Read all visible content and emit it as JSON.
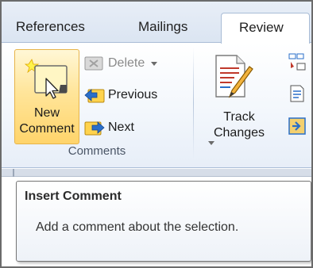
{
  "tabs": {
    "references": "References",
    "mailings": "Mailings",
    "review": "Review"
  },
  "comments_group": {
    "new_comment": [
      "New",
      "Comment"
    ],
    "delete": "Delete",
    "previous": "Previous",
    "next": "Next",
    "label": "Comments"
  },
  "tracking_group": {
    "track_changes": [
      "Track",
      "Changes"
    ]
  },
  "tooltip": {
    "title": "Insert Comment",
    "description": "Add a comment about the selection."
  },
  "icons": {
    "new_comment": "new-comment-icon",
    "delete": "delete-comment-icon",
    "previous": "previous-comment-icon",
    "next": "next-comment-icon",
    "track_changes": "track-changes-icon",
    "side_1": "balloons-icon",
    "side_2": "reviewing-pane-icon",
    "side_3": "show-markup-icon"
  },
  "colors": {
    "tab_strip": "#dbe5f2",
    "active_button": "#ffd46b",
    "active_button_border": "#e7b44a",
    "group_label": "#4a5566"
  }
}
